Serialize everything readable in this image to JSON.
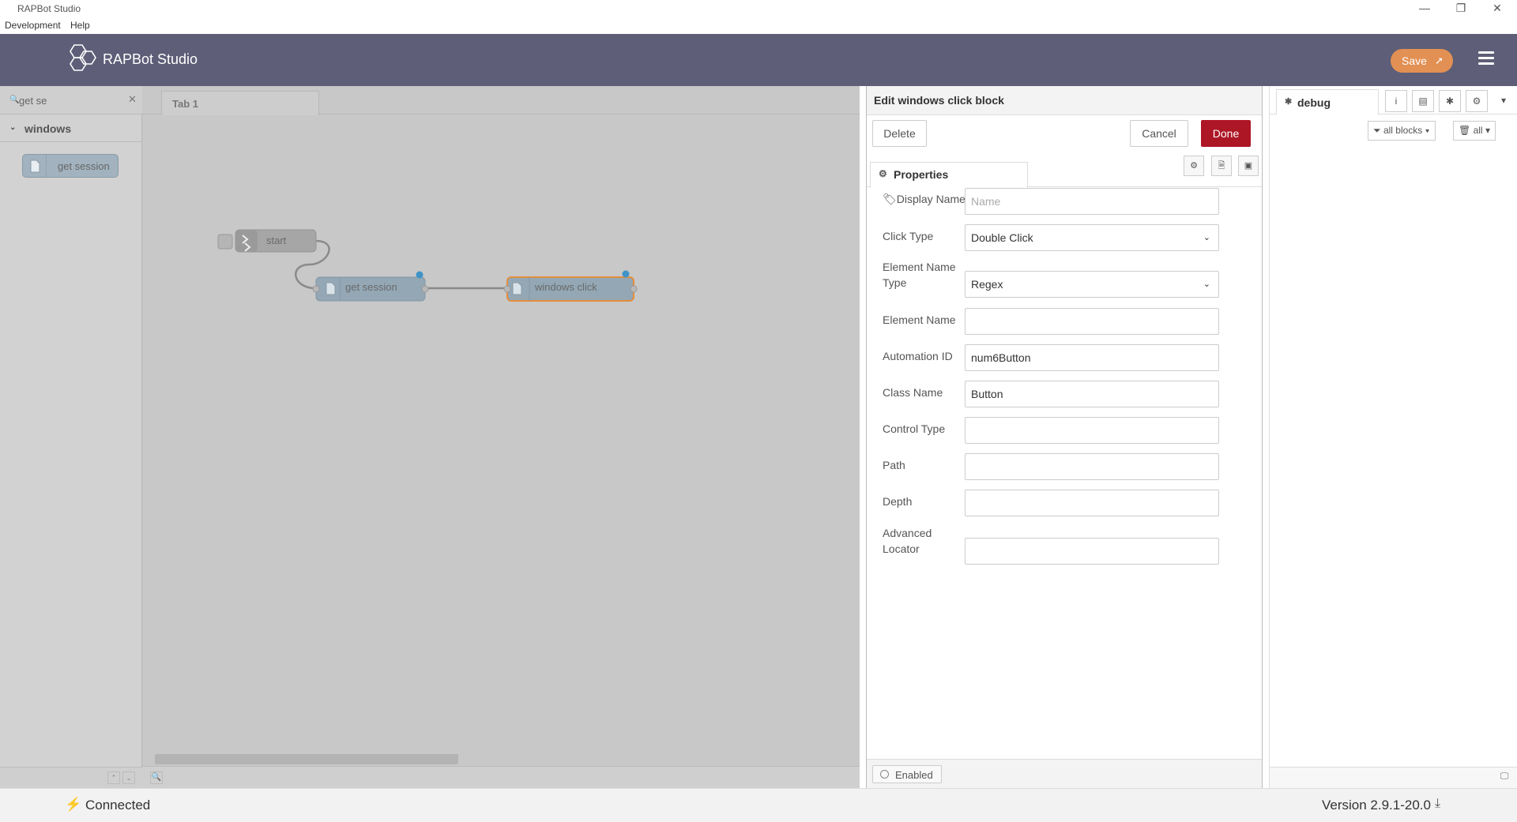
{
  "window": {
    "title": "RAPBot Studio",
    "minimize": "—",
    "restore": "❐",
    "close": "✕"
  },
  "menu": [
    "Development",
    "Help"
  ],
  "header": {
    "brand": "RAPBot Studio",
    "save_label": "Save",
    "bg_color": "#5e5e78",
    "save_color": "#e29053"
  },
  "palette": {
    "search_value": "get se",
    "category": "windows",
    "node": "get session"
  },
  "workspace": {
    "tab": "Tab 1",
    "nodes": {
      "start": "start",
      "get_session": "get session",
      "windows_click": "windows click"
    }
  },
  "tray": {
    "title": "Edit windows click block",
    "delete_label": "Delete",
    "cancel_label": "Cancel",
    "done_label": "Done",
    "tab_label": "Properties",
    "enabled_label": "Enabled",
    "fields": {
      "display_name": {
        "label": "Display Name",
        "placeholder": "Name",
        "value": ""
      },
      "click_type": {
        "label": "Click Type",
        "value": "Double Click"
      },
      "element_name_type": {
        "label": "Element Name Type",
        "value": "Regex"
      },
      "element_name": {
        "label": "Element Name",
        "value": ""
      },
      "automation_id": {
        "label": "Automation ID",
        "value": "num6Button"
      },
      "class_name": {
        "label": "Class Name",
        "value": "Button"
      },
      "control_type": {
        "label": "Control Type",
        "value": ""
      },
      "path": {
        "label": "Path",
        "value": ""
      },
      "depth": {
        "label": "Depth",
        "value": ""
      },
      "advanced_locator": {
        "label": "Advanced Locator",
        "value": ""
      }
    },
    "done_color": "#ad1625"
  },
  "sidebar": {
    "tab_label": "debug",
    "filter_label": "all blocks",
    "clear_label": "all"
  },
  "status": {
    "connection": "Connected",
    "version": "Version 2.9.1-20.0"
  }
}
